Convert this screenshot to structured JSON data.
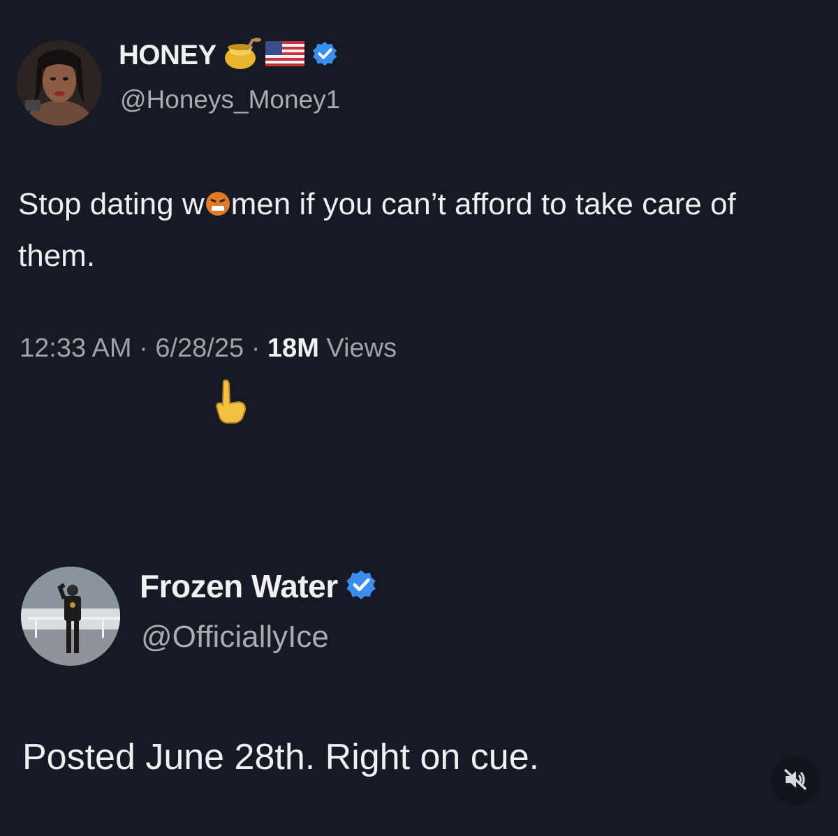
{
  "posts": [
    {
      "display_name": "HONEY",
      "handle": "@Honeys_Money1",
      "text_before": "Stop dating w",
      "text_after": "men if you can’t afford to take care of them.",
      "time": "12:33 AM",
      "date": "6/28/25",
      "views_count": "18M",
      "views_label": "Views",
      "separator": "·",
      "icons": [
        "honey-pot-icon",
        "us-flag-icon",
        "verified-badge-icon",
        "angry-face-icon",
        "pointing-down-icon"
      ]
    },
    {
      "display_name": "Frozen Water",
      "handle": "@OfficiallyIce",
      "text": "Posted June 28th. Right on cue.",
      "icons": [
        "verified-badge-icon",
        "muted-speaker-icon"
      ]
    }
  ],
  "colors": {
    "background": "#161a25",
    "verified_blue": "#3b8ef0",
    "handle_gray": "#a9adb3"
  }
}
